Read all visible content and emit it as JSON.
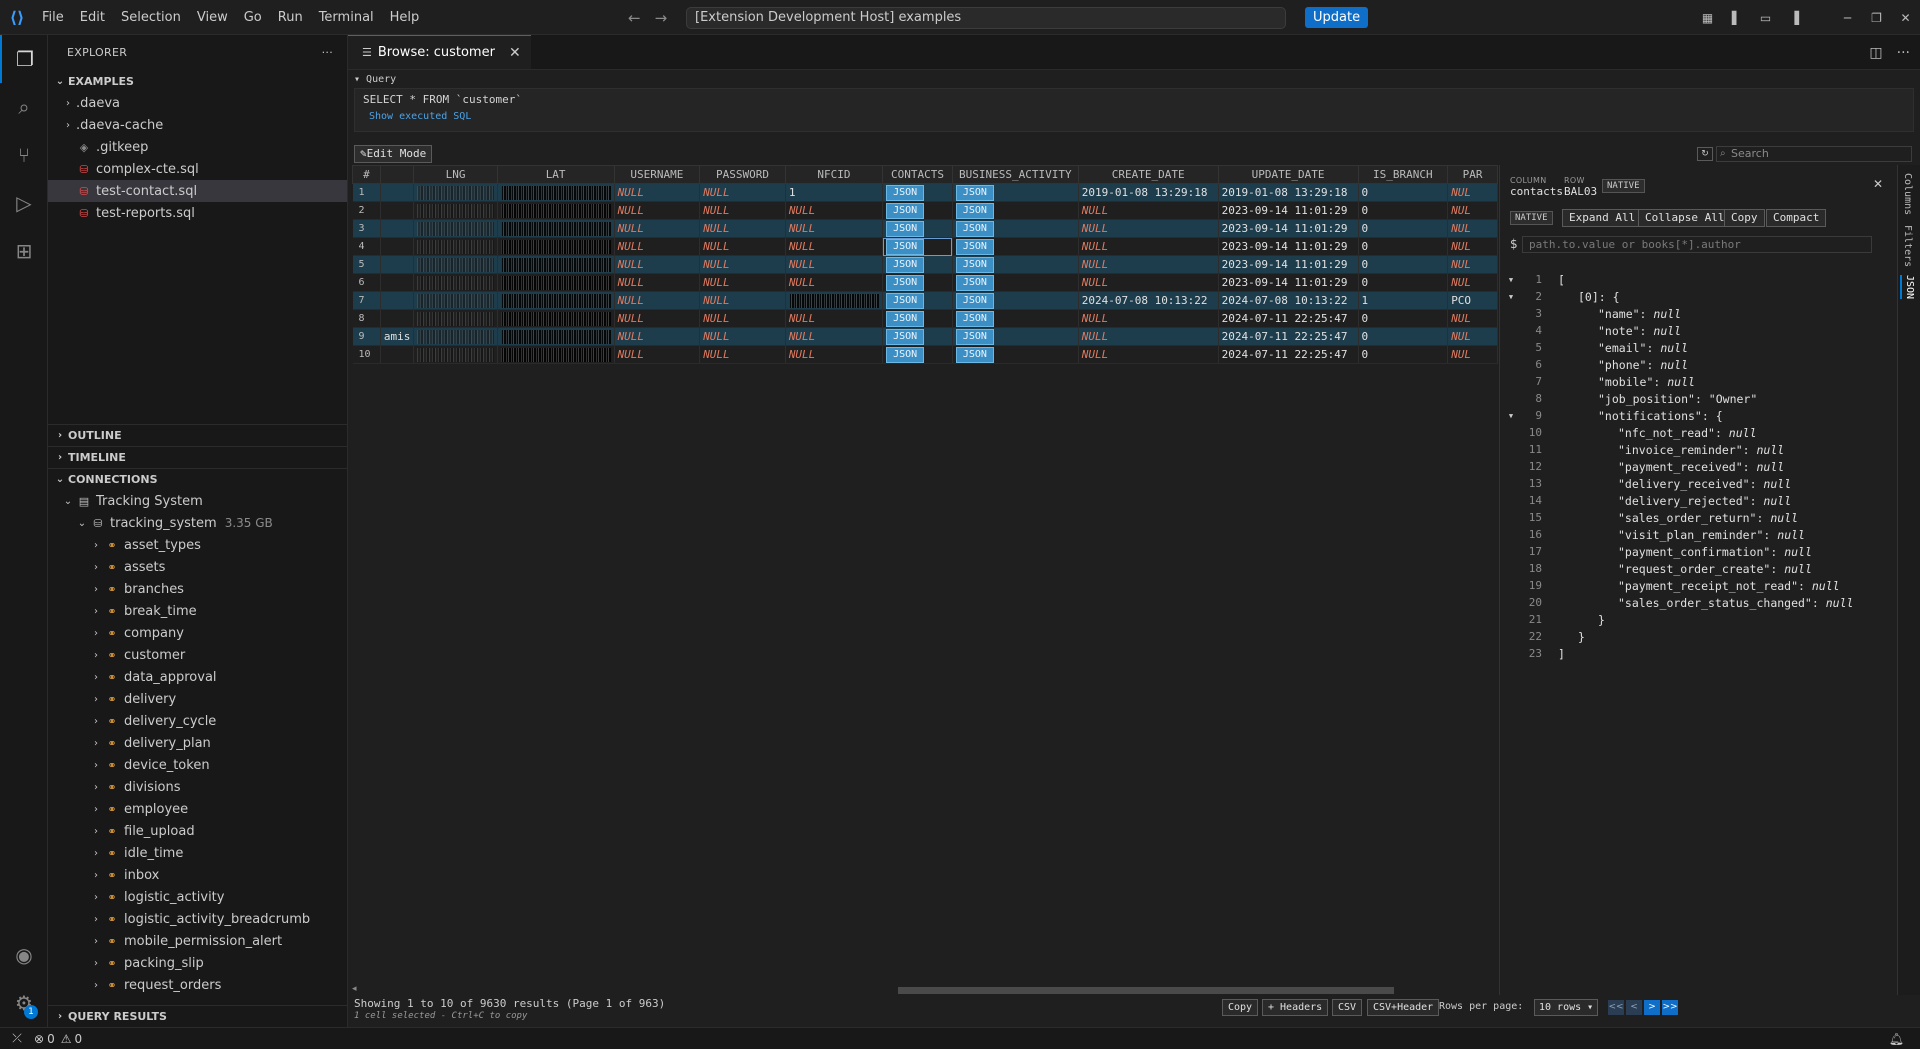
{
  "titlebar": {
    "menu": [
      "File",
      "Edit",
      "Selection",
      "View",
      "Go",
      "Run",
      "Terminal",
      "Help"
    ],
    "command_center": "[Extension Development Host] examples",
    "update_label": "Update"
  },
  "sidebar": {
    "title": "EXPLORER",
    "workspace": "EXAMPLES",
    "files": [
      {
        "name": ".daeva",
        "type": "folder"
      },
      {
        "name": ".daeva-cache",
        "type": "folder"
      },
      {
        "name": ".gitkeep",
        "type": "file"
      },
      {
        "name": "complex-cte.sql",
        "type": "sql"
      },
      {
        "name": "test-contact.sql",
        "type": "sql",
        "selected": true
      },
      {
        "name": "test-reports.sql",
        "type": "sql"
      }
    ],
    "outline": "OUTLINE",
    "timeline": "TIMELINE",
    "connections": "CONNECTIONS",
    "connection_name": "Tracking System",
    "database_name": "tracking_system",
    "database_size": "3.35 GB",
    "tables": [
      "asset_types",
      "assets",
      "branches",
      "break_time",
      "company",
      "customer",
      "data_approval",
      "delivery",
      "delivery_cycle",
      "delivery_plan",
      "device_token",
      "divisions",
      "employee",
      "file_upload",
      "idle_time",
      "inbox",
      "logistic_activity",
      "logistic_activity_breadcrumb",
      "mobile_permission_alert",
      "packing_slip",
      "request_orders"
    ],
    "query_results": "QUERY RESULTS"
  },
  "editor": {
    "tab_label": "Browse: customer",
    "query_label": "Query",
    "sql": "SELECT * FROM `customer`",
    "show_sql": "Show executed SQL",
    "edit_mode": "Edit Mode",
    "search_placeholder": "Search"
  },
  "grid": {
    "columns": [
      "#",
      "",
      "LNG",
      "LAT",
      "USERNAME",
      "PASSWORD",
      "NFCID",
      "CONTACTS",
      "BUSINESS_ACTIVITY",
      "CREATE_DATE",
      "UPDATE_DATE",
      "IS_BRANCH",
      "PAR"
    ],
    "rows": [
      {
        "n": "1",
        "name": "",
        "username": "NULL",
        "password": "NULL",
        "nfcid": "1",
        "contacts": "JSON",
        "business": "JSON",
        "create": "2019-01-08 13:29:18",
        "update": "2019-01-08 13:29:18",
        "branch": "0",
        "par": "NUL"
      },
      {
        "n": "2",
        "name": "",
        "username": "NULL",
        "password": "NULL",
        "nfcid": "NULL",
        "contacts": "JSON",
        "business": "JSON",
        "create": "NULL",
        "update": "2023-09-14 11:01:29",
        "branch": "0",
        "par": "NUL"
      },
      {
        "n": "3",
        "name": "",
        "username": "NULL",
        "password": "NULL",
        "nfcid": "NULL",
        "contacts": "JSON",
        "business": "JSON",
        "create": "NULL",
        "update": "2023-09-14 11:01:29",
        "branch": "0",
        "par": "NUL"
      },
      {
        "n": "4",
        "name": "",
        "username": "NULL",
        "password": "NULL",
        "nfcid": "NULL",
        "contacts": "JSON",
        "business": "JSON",
        "create": "NULL",
        "update": "2023-09-14 11:01:29",
        "branch": "0",
        "par": "NUL"
      },
      {
        "n": "5",
        "name": "",
        "username": "NULL",
        "password": "NULL",
        "nfcid": "NULL",
        "contacts": "JSON",
        "business": "JSON",
        "create": "NULL",
        "update": "2023-09-14 11:01:29",
        "branch": "0",
        "par": "NUL"
      },
      {
        "n": "6",
        "name": "",
        "username": "NULL",
        "password": "NULL",
        "nfcid": "NULL",
        "contacts": "JSON",
        "business": "JSON",
        "create": "NULL",
        "update": "2023-09-14 11:01:29",
        "branch": "0",
        "par": "NUL"
      },
      {
        "n": "7",
        "name": "",
        "username": "NULL",
        "password": "NULL",
        "nfcid": "",
        "contacts": "JSON",
        "business": "JSON",
        "create": "2024-07-08 10:13:22",
        "update": "2024-07-08 10:13:22",
        "branch": "1",
        "par": "PCO"
      },
      {
        "n": "8",
        "name": "",
        "username": "NULL",
        "password": "NULL",
        "nfcid": "NULL",
        "contacts": "JSON",
        "business": "JSON",
        "create": "NULL",
        "update": "2024-07-11 22:25:47",
        "branch": "0",
        "par": "NUL"
      },
      {
        "n": "9",
        "name": "amis",
        "username": "NULL",
        "password": "NULL",
        "nfcid": "NULL",
        "contacts": "JSON",
        "business": "JSON",
        "create": "NULL",
        "update": "2024-07-11 22:25:47",
        "branch": "0",
        "par": "NUL"
      },
      {
        "n": "10",
        "name": "",
        "username": "NULL",
        "password": "NULL",
        "nfcid": "NULL",
        "contacts": "JSON",
        "business": "JSON",
        "create": "NULL",
        "update": "2024-07-11 22:25:47",
        "branch": "0",
        "par": "NUL"
      }
    ]
  },
  "json_panel": {
    "column_label": "COLUMN",
    "column_value": "contacts",
    "row_label": "ROW",
    "row_value": "BAL03",
    "native": "NATIVE",
    "native_toggle": "NATIVE",
    "expand_all": "Expand All",
    "collapse_all": "Collapse All",
    "copy": "Copy",
    "compact": "Compact",
    "path_placeholder": "path.to.value or books[*].author",
    "lines": [
      {
        "fold": "▼",
        "indent": 0,
        "text": "["
      },
      {
        "fold": "▼",
        "indent": 1,
        "text": "[0]: {"
      },
      {
        "fold": "",
        "indent": 2,
        "key": "\"name\"",
        "val": "null",
        "vt": "null"
      },
      {
        "fold": "",
        "indent": 2,
        "key": "\"note\"",
        "val": "null",
        "vt": "null"
      },
      {
        "fold": "",
        "indent": 2,
        "key": "\"email\"",
        "val": "null",
        "vt": "null"
      },
      {
        "fold": "",
        "indent": 2,
        "key": "\"phone\"",
        "val": "null",
        "vt": "null"
      },
      {
        "fold": "",
        "indent": 2,
        "key": "\"mobile\"",
        "val": "null",
        "vt": "null"
      },
      {
        "fold": "",
        "indent": 2,
        "key": "\"job_position\"",
        "val": "\"Owner\"",
        "vt": "str"
      },
      {
        "fold": "▼",
        "indent": 2,
        "key": "\"notifications\"",
        "val": "{",
        "vt": "str"
      },
      {
        "fold": "",
        "indent": 3,
        "key": "\"nfc_not_read\"",
        "val": "null",
        "vt": "null"
      },
      {
        "fold": "",
        "indent": 3,
        "key": "\"invoice_reminder\"",
        "val": "null",
        "vt": "null"
      },
      {
        "fold": "",
        "indent": 3,
        "key": "\"payment_received\"",
        "val": "null",
        "vt": "null"
      },
      {
        "fold": "",
        "indent": 3,
        "key": "\"delivery_received\"",
        "val": "null",
        "vt": "null"
      },
      {
        "fold": "",
        "indent": 3,
        "key": "\"delivery_rejected\"",
        "val": "null",
        "vt": "null"
      },
      {
        "fold": "",
        "indent": 3,
        "key": "\"sales_order_return\"",
        "val": "null",
        "vt": "null"
      },
      {
        "fold": "",
        "indent": 3,
        "key": "\"visit_plan_reminder\"",
        "val": "null",
        "vt": "null"
      },
      {
        "fold": "",
        "indent": 3,
        "key": "\"payment_confirmation\"",
        "val": "null",
        "vt": "null"
      },
      {
        "fold": "",
        "indent": 3,
        "key": "\"request_order_create\"",
        "val": "null",
        "vt": "null"
      },
      {
        "fold": "",
        "indent": 3,
        "key": "\"payment_receipt_not_read\"",
        "val": "null",
        "vt": "null"
      },
      {
        "fold": "",
        "indent": 3,
        "key": "\"sales_order_status_changed\"",
        "val": "null",
        "vt": "null"
      },
      {
        "fold": "",
        "indent": 2,
        "text": "}"
      },
      {
        "fold": "",
        "indent": 1,
        "text": "}"
      },
      {
        "fold": "",
        "indent": 0,
        "text": "]"
      }
    ]
  },
  "rail": {
    "columns": "Columns",
    "filters": "Filters",
    "json": "JSON"
  },
  "footer": {
    "showing": "Showing 1 to 10 of 9630 results (Page 1 of 963)",
    "selection": "1 cell selected - Ctrl+C to copy",
    "copy": "Copy",
    "headers": "+ Headers",
    "csv": "CSV",
    "csv_header": "CSV+Header",
    "rows_per_page": "Rows per page:",
    "rows_value": "10 rows ▾",
    "pager": [
      "<<",
      "<",
      ">",
      ">>"
    ]
  },
  "statusbar": {
    "errors": "0",
    "warnings": "0"
  }
}
